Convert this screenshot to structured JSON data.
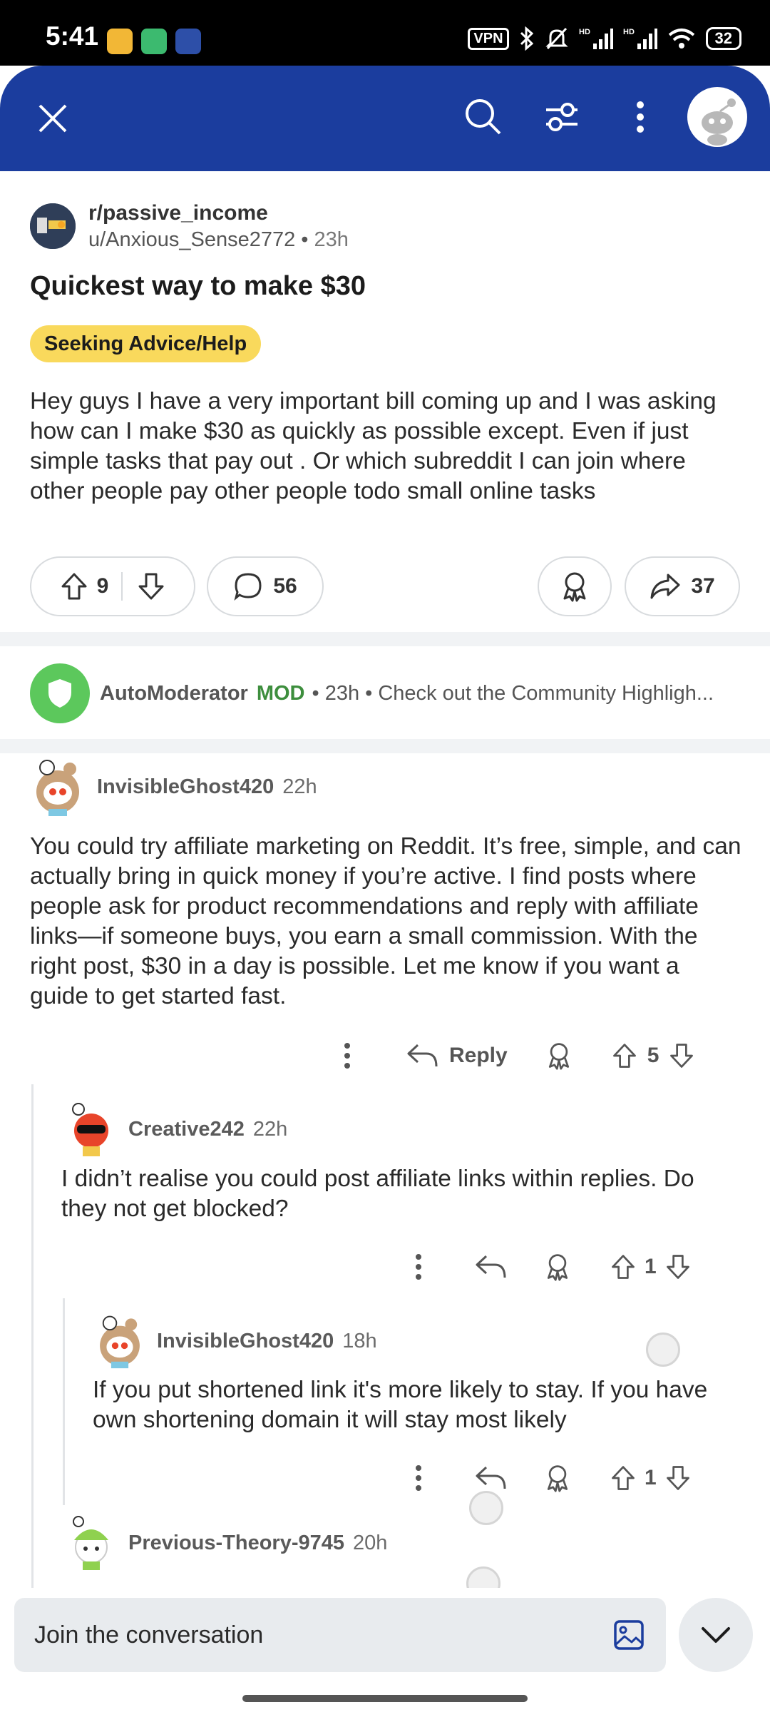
{
  "status_bar": {
    "time": "5:41",
    "vpn": "VPN",
    "battery": "32",
    "signal1": "HD",
    "signal2": "HD"
  },
  "top_bar": {
    "close": "close",
    "search": "search",
    "filter": "filter",
    "more": "more",
    "avatar": "user avatar"
  },
  "post": {
    "subreddit": "r/passive_income",
    "author": "u/Anxious_Sense2772",
    "time": "23h",
    "title": "Quickest way to make $30",
    "flair": "Seeking Advice/Help",
    "body": "Hey guys I have a very important bill coming up and I was asking how can I make $30 as quickly as possible except. Even if just simple tasks that pay out . Or which subreddit I can join where other people pay other people todo small online tasks",
    "upvotes": "9",
    "comments": "56",
    "shares": "37"
  },
  "automod": {
    "name": "AutoModerator",
    "badge": "MOD",
    "meta": "• 23h • Check out the Community Highligh..."
  },
  "comments": [
    {
      "user": "InvisibleGhost420",
      "time": "22h",
      "body": "You could try affiliate marketing on Reddit. It’s free, simple, and can actually bring in quick money if you’re active. I find posts where people ask for product recommendations and reply with affiliate links—if someone buys, you earn a small commission. With the right post, $30 in a day is possible. Let me know if you want a guide to get started fast.",
      "reply_label": "Reply",
      "votes": "5"
    },
    {
      "user": "Creative242",
      "time": "22h",
      "body": "I didn’t realise you could post affiliate links within replies. Do they not get blocked?",
      "votes": "1"
    },
    {
      "user": "InvisibleGhost420",
      "time": "18h",
      "body": "If you put shortened link it's more likely to stay. If you have own shortening domain it will stay most likely",
      "votes": "1"
    },
    {
      "user": "Previous-Theory-9745",
      "time": "20h"
    }
  ],
  "composer": {
    "placeholder": "Join the conversation"
  },
  "colors": {
    "header": "#1b3d9e",
    "flair": "#f9d95c",
    "mod": "#3d8e3d",
    "automod_avatar": "#5cc85c"
  }
}
